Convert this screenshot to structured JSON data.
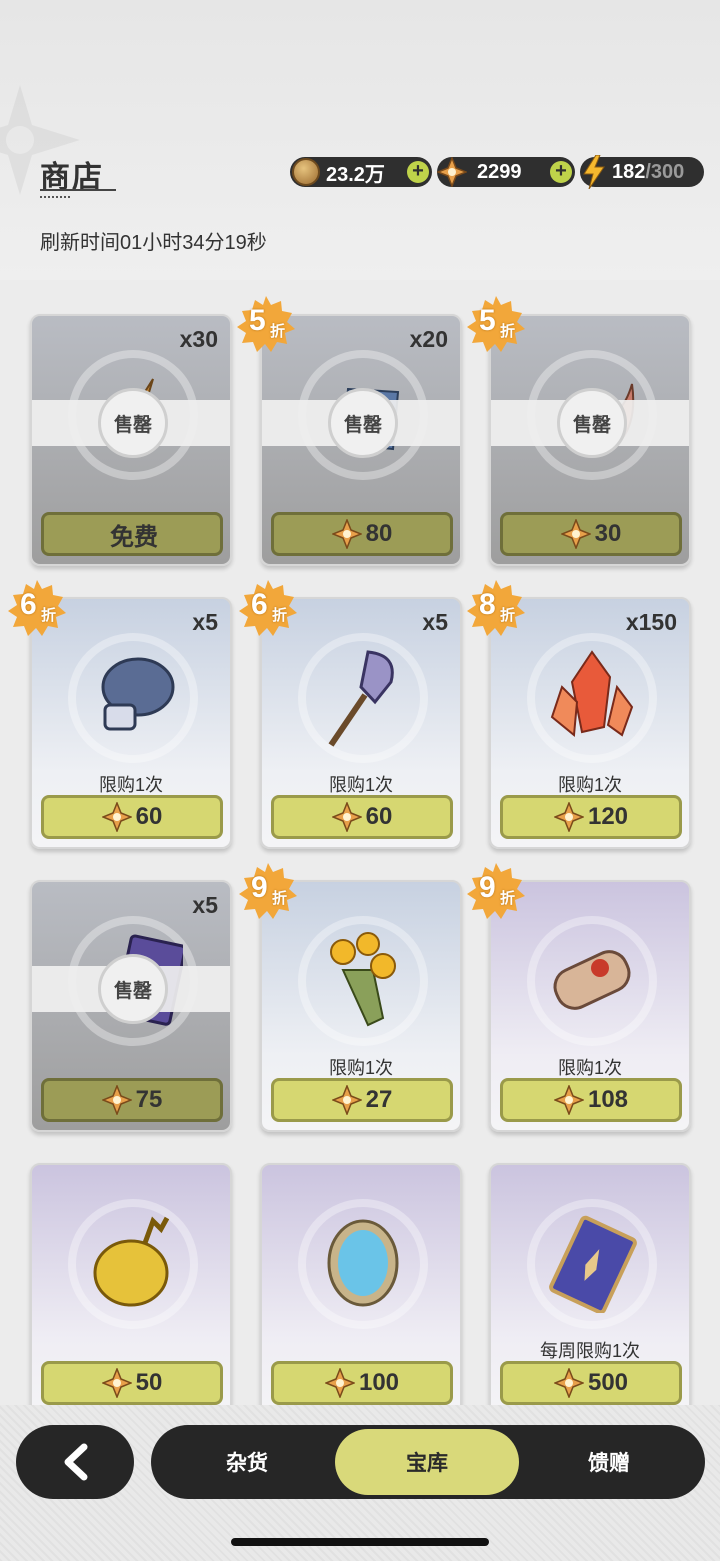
{
  "header": {
    "title": "商店",
    "refresh_text": "刷新时间01小时34分19秒"
  },
  "resources": {
    "coins": "23.2万",
    "gems": "2299",
    "stamina_current": "182",
    "stamina_max": "/300",
    "plus": "+"
  },
  "colors": {
    "accent": "#d6d771",
    "dark": "#262626",
    "discount_badge": "#f2a73a"
  },
  "cards": [
    {
      "qty": "x30",
      "price": "免费",
      "sold_label": "售罄",
      "item": "compass-needle-item",
      "status": "sold"
    },
    {
      "qty": "x20",
      "price": "80",
      "sold_label": "售罄",
      "discount": "5",
      "discount_unit": "折",
      "item": "book-item",
      "status": "sold"
    },
    {
      "price": "30",
      "sold_label": "售罄",
      "discount": "5",
      "discount_unit": "折",
      "item": "horn-item",
      "status": "sold"
    },
    {
      "qty": "x5",
      "price": "60",
      "limit": "限购1次",
      "discount": "6",
      "discount_unit": "折",
      "item": "boxing-glove-item"
    },
    {
      "qty": "x5",
      "price": "60",
      "limit": "限购1次",
      "discount": "6",
      "discount_unit": "折",
      "item": "shovel-item"
    },
    {
      "qty": "x150",
      "price": "120",
      "limit": "限购1次",
      "discount": "8",
      "discount_unit": "折",
      "item": "crystal-item"
    },
    {
      "qty": "x5",
      "price": "75",
      "sold_label": "售罄",
      "item": "card-item",
      "status": "sold"
    },
    {
      "price": "27",
      "limit": "限购1次",
      "discount": "9",
      "discount_unit": "折",
      "item": "flower-bouquet-item"
    },
    {
      "price": "108",
      "limit": "限购1次",
      "discount": "9",
      "discount_unit": "折",
      "item": "scroll-item"
    },
    {
      "price": "50",
      "item": "golden-seed-item"
    },
    {
      "price": "100",
      "item": "mirror-item"
    },
    {
      "price": "500",
      "limit": "每周限购1次",
      "item": "tarot-card-item"
    }
  ],
  "tabs": {
    "items": [
      "杂货",
      "宝库",
      "馈赠"
    ],
    "active": "宝库"
  }
}
